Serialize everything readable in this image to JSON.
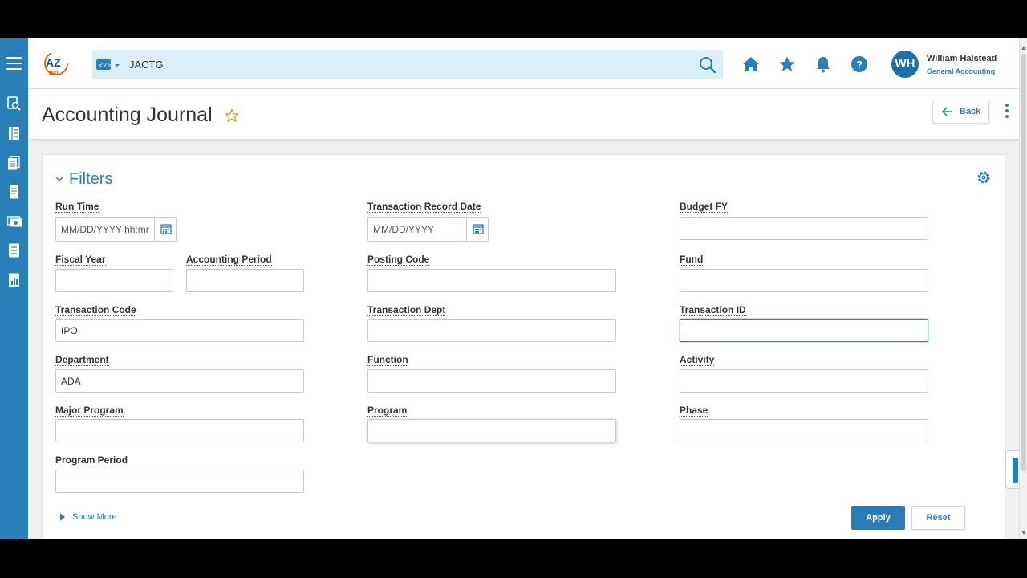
{
  "app": {
    "logo_text": "AZ 360",
    "accent": "#2980b9"
  },
  "search": {
    "value": "JACTG",
    "scope_icon": "code-icon",
    "search_icon": "search-icon"
  },
  "header_icons": [
    "home-icon",
    "star-icon",
    "bell-icon",
    "help-icon"
  ],
  "user": {
    "initials": "WH",
    "name": "William Halstead",
    "role": "General Accounting"
  },
  "page": {
    "title": "Accounting Journal",
    "back_label": "Back"
  },
  "filters": {
    "title": "Filters",
    "run_time": {
      "label": "Run Time",
      "placeholder": "MM/DD/YYYY hh:mm"
    },
    "transaction_record_date": {
      "label": "Transaction Record Date",
      "placeholder": "MM/DD/YYYY"
    },
    "budget_fy": {
      "label": "Budget FY",
      "value": ""
    },
    "fiscal_year": {
      "label": "Fiscal Year",
      "value": ""
    },
    "accounting_period": {
      "label": "Accounting Period",
      "value": ""
    },
    "posting_code": {
      "label": "Posting Code",
      "value": ""
    },
    "fund": {
      "label": "Fund",
      "value": ""
    },
    "transaction_code": {
      "label": "Transaction Code",
      "value": "IPO"
    },
    "transaction_dept": {
      "label": "Transaction Dept",
      "value": ""
    },
    "transaction_id": {
      "label": "Transaction ID",
      "value": ""
    },
    "department": {
      "label": "Department",
      "value": "ADA"
    },
    "function": {
      "label": "Function",
      "value": ""
    },
    "activity": {
      "label": "Activity",
      "value": ""
    },
    "major_program": {
      "label": "Major Program",
      "value": ""
    },
    "program": {
      "label": "Program",
      "value": ""
    },
    "phase": {
      "label": "Phase",
      "value": ""
    },
    "program_period": {
      "label": "Program Period",
      "value": ""
    },
    "show_more": "Show More",
    "apply": "Apply",
    "reset": "Reset"
  }
}
